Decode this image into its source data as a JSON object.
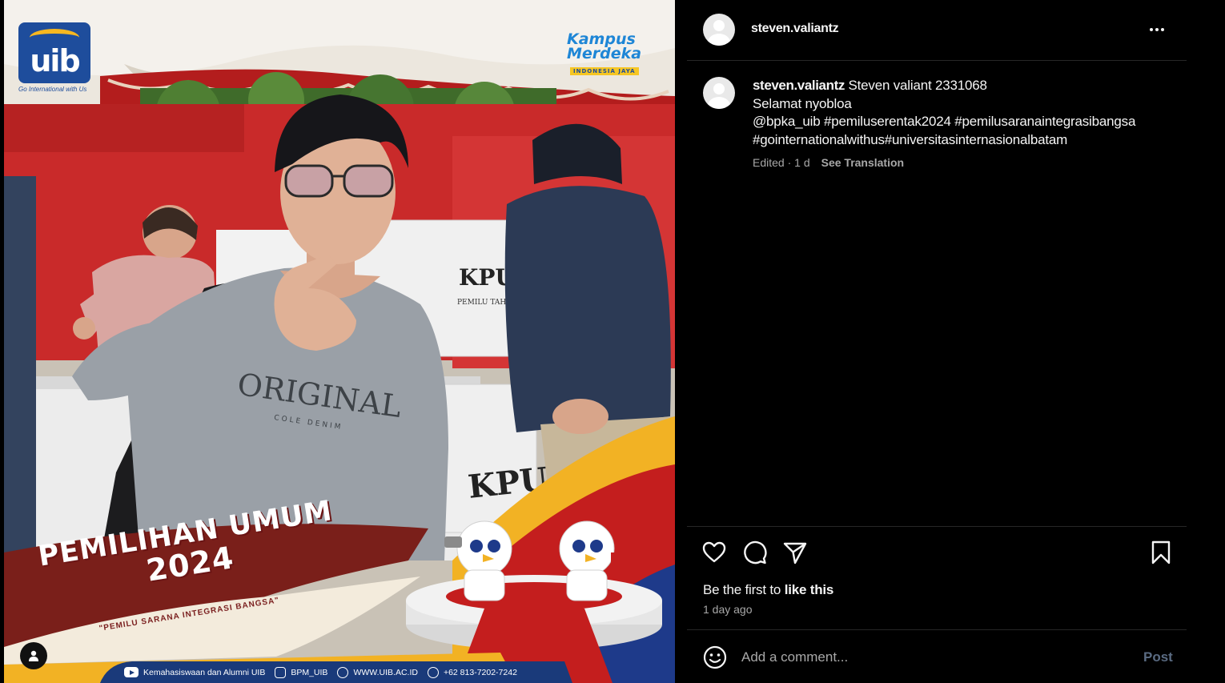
{
  "post": {
    "username": "steven.valiantz",
    "more_label": "More options",
    "caption": {
      "username": "steven.valiantz",
      "line1": "Steven valiant 2331068",
      "line2": "Selamat nyobloa",
      "line3": "@bpka_uib #pemiluserentak2024 #pemilusaranaintegrasibangsa",
      "line4": "#gointernationalwithus#universitasinternasionalbatam"
    },
    "meta": {
      "edited": "Edited · 1 d",
      "see_translation": "See Translation"
    },
    "likes": {
      "prefix": "Be the first to ",
      "action": "like this"
    },
    "time": "1 day ago",
    "comment": {
      "placeholder": "Add a comment...",
      "post_label": "Post"
    }
  },
  "image": {
    "logo_text": "uib",
    "logo_tagline": "Go International with Us",
    "kampus_line1": "Kampus",
    "kampus_line2": "Merdeka",
    "kampus_sub": "INDONESIA JAYA",
    "banner_title": "PEMILIHAN UMUM",
    "banner_year": "2024",
    "banner_tagline": "\"PEMILU SARANA INTEGRASI BANGSA\"",
    "shirt_text": "ORIGINAL",
    "shirt_sub": "COLE DENIM",
    "kpu1": "KPU",
    "kpu1_sub": "PEMILU TAHUN 202",
    "kpu2": "KPU",
    "footer": {
      "youtube": "Kemahasiswaan dan Alumni UIB",
      "instagram": "BPM_UIB",
      "web": "WWW.UIB.AC.ID",
      "phone": "+62 813-7202-7242"
    }
  },
  "colors": {
    "background": "#000000",
    "text_primary": "#f5f5f5",
    "text_secondary": "#a8a8a8",
    "divider": "#262626",
    "post_button_disabled": "#5a6b82",
    "uib_blue": "#1e4d9c",
    "banner_red": "#c41e1e"
  }
}
